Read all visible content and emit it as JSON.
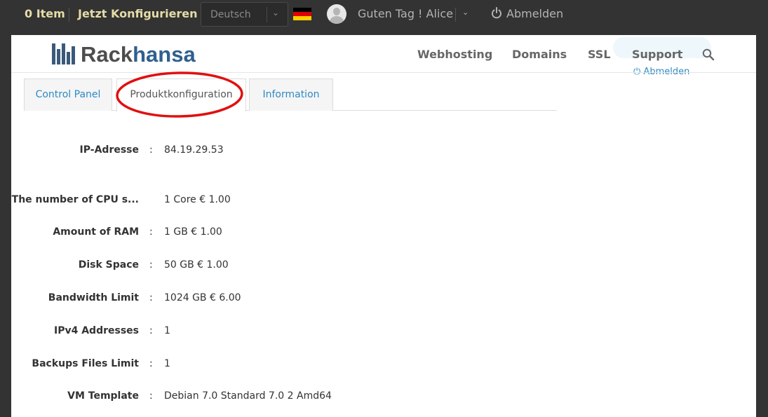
{
  "topbar": {
    "cart_label": "0 Item",
    "configure_label": "Jetzt Konfigurieren",
    "language": "Deutsch",
    "greeting": "Guten Tag ! Alice",
    "logout_label": "Abmelden"
  },
  "header": {
    "logo_part1": "Rack",
    "logo_part2": "hansa",
    "nav": [
      "Webhosting",
      "Domains",
      "SSL",
      "Support"
    ],
    "hidden_logout": "Abmelden"
  },
  "tabs": [
    {
      "label": "Control Panel",
      "active": false
    },
    {
      "label": "Produktkonfiguration",
      "active": true
    },
    {
      "label": "Information",
      "active": false
    }
  ],
  "details": [
    {
      "label": "IP-Adresse",
      "colon": ":",
      "value": "84.19.29.53"
    },
    {
      "label": "The number of CPU s...",
      "colon": "",
      "value": "1 Core € 1.00"
    },
    {
      "label": "Amount of RAM",
      "colon": ":",
      "value": "1 GB € 1.00"
    },
    {
      "label": "Disk Space",
      "colon": ":",
      "value": "50 GB € 1.00"
    },
    {
      "label": "Bandwidth Limit",
      "colon": ":",
      "value": "1024 GB € 6.00"
    },
    {
      "label": "IPv4 Addresses",
      "colon": ":",
      "value": "1"
    },
    {
      "label": "Backups Files Limit",
      "colon": ":",
      "value": "1"
    },
    {
      "label": "VM Template",
      "colon": ":",
      "value": "Debian 7.0 Standard 7.0 2 Amd64"
    }
  ],
  "colors": {
    "topbar_bg": "#333333",
    "accent_link": "#2e8ac4",
    "highlight_circle": "#e01010"
  },
  "icons": [
    "user-avatar-icon",
    "power-icon",
    "search-icon",
    "german-flag-icon",
    "chevron-down-icon"
  ]
}
